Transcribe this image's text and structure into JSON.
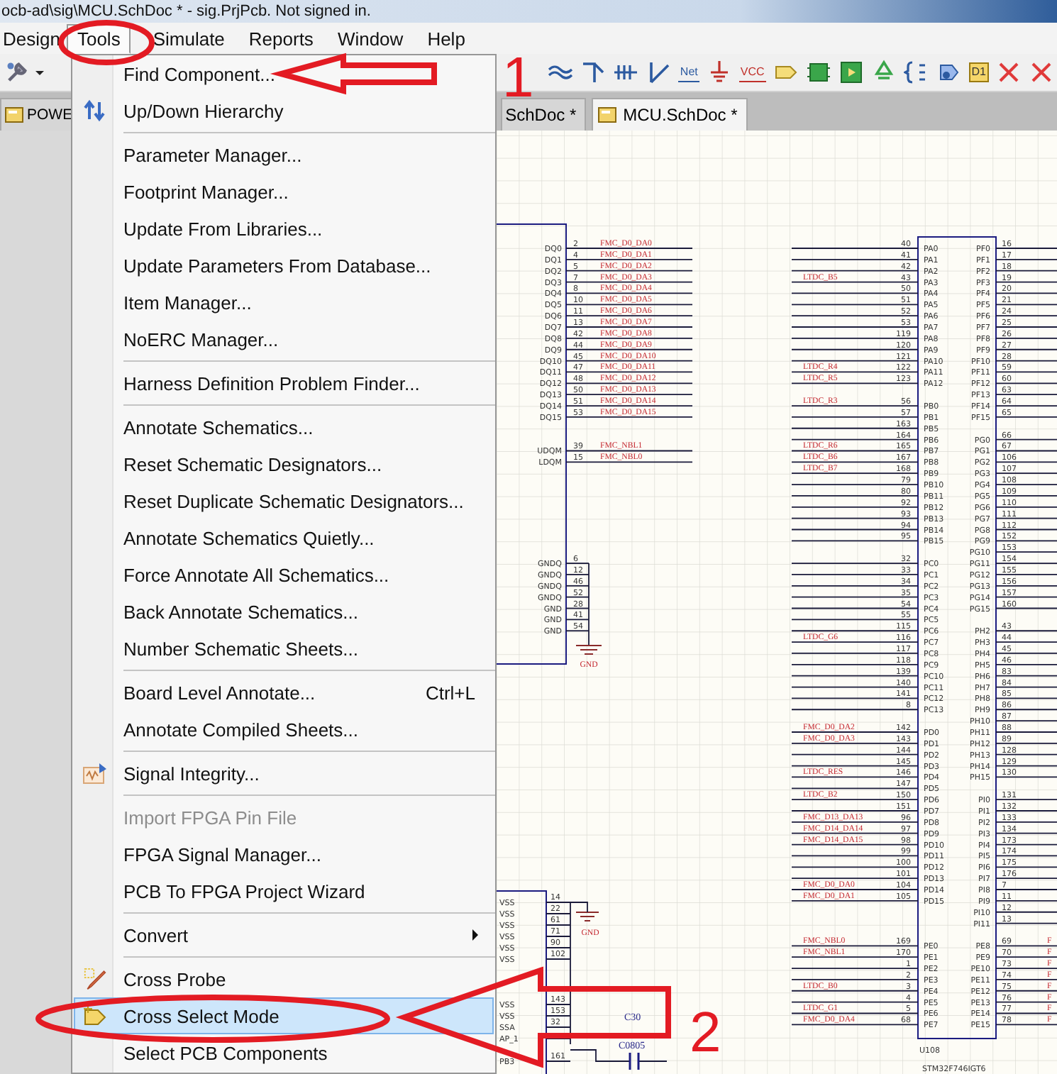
{
  "window": {
    "title": "ocb-ad\\sig\\MCU.SchDoc * - sig.PrjPcb. Not signed in."
  },
  "menubar": [
    {
      "label": "Design",
      "selected": false
    },
    {
      "label": "Tools",
      "selected": true
    },
    {
      "label": "Simulate",
      "selected": false
    },
    {
      "label": "Reports",
      "selected": false
    },
    {
      "label": "Window",
      "selected": false
    },
    {
      "label": "Help",
      "selected": false
    }
  ],
  "toolbar": {
    "left": [
      {
        "kind": "wrench"
      },
      {
        "kind": "caret"
      }
    ],
    "right": [
      {
        "kind": "bus"
      },
      {
        "kind": "bus-entry"
      },
      {
        "kind": "harness"
      },
      {
        "kind": "wire"
      },
      {
        "kind": "net-label",
        "label": "Net"
      },
      {
        "kind": "ground"
      },
      {
        "kind": "power",
        "label": "VCC"
      },
      {
        "kind": "port"
      },
      {
        "kind": "part"
      },
      {
        "kind": "sheet"
      },
      {
        "kind": "recycle"
      },
      {
        "kind": "brace"
      },
      {
        "kind": "sheet-entry"
      },
      {
        "kind": "off-sheet",
        "label": "D1"
      },
      {
        "kind": "cross"
      },
      {
        "kind": "cross"
      }
    ]
  },
  "tabs": [
    {
      "label": "POWE",
      "selected": false
    },
    {
      "label": "SchDoc *",
      "selected": false
    },
    {
      "label": "MCU.SchDoc *",
      "selected": true
    }
  ],
  "tools_menu": [
    {
      "kind": "item",
      "label": "Find Component...",
      "disabled": false,
      "selected": false
    },
    {
      "kind": "item",
      "label": "Up/Down Hierarchy",
      "disabled": false,
      "selected": false
    },
    {
      "kind": "separator"
    },
    {
      "kind": "item",
      "label": "Parameter Manager...",
      "disabled": false,
      "selected": false
    },
    {
      "kind": "item",
      "label": "Footprint Manager...",
      "disabled": false,
      "selected": false
    },
    {
      "kind": "item",
      "label": "Update From Libraries...",
      "disabled": false,
      "selected": false
    },
    {
      "kind": "item",
      "label": "Update Parameters From Database...",
      "disabled": false,
      "selected": false
    },
    {
      "kind": "item",
      "label": "Item Manager...",
      "disabled": false,
      "selected": false
    },
    {
      "kind": "item",
      "label": "NoERC Manager...",
      "disabled": false,
      "selected": false
    },
    {
      "kind": "separator"
    },
    {
      "kind": "item",
      "label": "Harness Definition Problem Finder...",
      "disabled": false,
      "selected": false
    },
    {
      "kind": "separator"
    },
    {
      "kind": "item",
      "label": "Annotate Schematics...",
      "disabled": false,
      "selected": false
    },
    {
      "kind": "item",
      "label": "Reset Schematic Designators...",
      "disabled": false,
      "selected": false
    },
    {
      "kind": "item",
      "label": "Reset Duplicate Schematic Designators...",
      "disabled": false,
      "selected": false
    },
    {
      "kind": "item",
      "label": "Annotate Schematics Quietly...",
      "disabled": false,
      "selected": false
    },
    {
      "kind": "item",
      "label": "Force Annotate All Schematics...",
      "disabled": false,
      "selected": false
    },
    {
      "kind": "item",
      "label": "Back Annotate Schematics...",
      "disabled": false,
      "selected": false
    },
    {
      "kind": "item",
      "label": "Number Schematic Sheets...",
      "disabled": false,
      "selected": false
    },
    {
      "kind": "separator"
    },
    {
      "kind": "item",
      "label": "Board Level Annotate...",
      "shortcut": "Ctrl+L",
      "disabled": false,
      "selected": false
    },
    {
      "kind": "item",
      "label": "Annotate Compiled Sheets...",
      "disabled": false,
      "selected": false
    },
    {
      "kind": "separator"
    },
    {
      "kind": "item",
      "label": "Signal Integrity...",
      "disabled": false,
      "selected": false
    },
    {
      "kind": "separator"
    },
    {
      "kind": "item",
      "label": "Import FPGA Pin File",
      "disabled": true,
      "selected": false
    },
    {
      "kind": "item",
      "label": "FPGA Signal Manager...",
      "disabled": false,
      "selected": false
    },
    {
      "kind": "item",
      "label": "PCB To FPGA Project Wizard",
      "disabled": false,
      "selected": false
    },
    {
      "kind": "separator"
    },
    {
      "kind": "item",
      "label": "Convert",
      "submenu": true,
      "disabled": false,
      "selected": false
    },
    {
      "kind": "separator"
    },
    {
      "kind": "item",
      "label": "Cross Probe",
      "disabled": false,
      "selected": false
    },
    {
      "kind": "item",
      "label": "Cross Select Mode",
      "disabled": false,
      "selected": true
    },
    {
      "kind": "item",
      "label": "Select PCB Components",
      "disabled": false,
      "selected": false
    }
  ],
  "schematic": {
    "memory_chip": {
      "groups": [
        {
          "kind": "signal",
          "pins": [
            {
              "name": "DQ0",
              "pin": "2",
              "net": "FMC_D0_DA0"
            },
            {
              "name": "DQ1",
              "pin": "4",
              "net": "FMC_D0_DA1"
            },
            {
              "name": "DQ2",
              "pin": "5",
              "net": "FMC_D0_DA2"
            },
            {
              "name": "DQ3",
              "pin": "7",
              "net": "FMC_D0_DA3"
            },
            {
              "name": "DQ4",
              "pin": "8",
              "net": "FMC_D0_DA4"
            },
            {
              "name": "DQ5",
              "pin": "10",
              "net": "FMC_D0_DA5"
            },
            {
              "name": "DQ6",
              "pin": "11",
              "net": "FMC_D0_DA6"
            },
            {
              "name": "DQ7",
              "pin": "13",
              "net": "FMC_D0_DA7"
            },
            {
              "name": "DQ8",
              "pin": "42",
              "net": "FMC_D0_DA8"
            },
            {
              "name": "DQ9",
              "pin": "44",
              "net": "FMC_D0_DA9"
            },
            {
              "name": "DQ10",
              "pin": "45",
              "net": "FMC_D0_DA10"
            },
            {
              "name": "DQ11",
              "pin": "47",
              "net": "FMC_D0_DA11"
            },
            {
              "name": "DQ12",
              "pin": "48",
              "net": "FMC_D0_DA12"
            },
            {
              "name": "DQ13",
              "pin": "50",
              "net": "FMC_D0_DA13"
            },
            {
              "name": "DQ14",
              "pin": "51",
              "net": "FMC_D0_DA14"
            },
            {
              "name": "DQ15",
              "pin": "53",
              "net": "FMC_D0_DA15"
            }
          ]
        },
        {
          "kind": "signal",
          "pins": [
            {
              "name": "UDQM",
              "pin": "39",
              "net": "FMC_NBL1"
            },
            {
              "name": "LDQM",
              "pin": "15",
              "net": "FMC_NBL0"
            }
          ]
        },
        {
          "kind": "ground",
          "ground_label": "GND",
          "pins": [
            {
              "name": "GNDQ",
              "pin": "6"
            },
            {
              "name": "GNDQ",
              "pin": "12"
            },
            {
              "name": "GNDQ",
              "pin": "46"
            },
            {
              "name": "GNDQ",
              "pin": "52"
            },
            {
              "name": "GND",
              "pin": "28"
            },
            {
              "name": "GND",
              "pin": "41"
            },
            {
              "name": "GND",
              "pin": "54"
            }
          ]
        }
      ]
    },
    "mcu": {
      "designator": "U108",
      "part": "STM32F746IGT6",
      "left_groups": [
        [
          {
            "name": "PA0",
            "pin": "40"
          },
          {
            "name": "PA1",
            "pin": "41"
          },
          {
            "name": "PA2",
            "pin": "42"
          },
          {
            "name": "PA3",
            "pin": "43",
            "net": "LTDC_B5"
          },
          {
            "name": "PA4",
            "pin": "50"
          },
          {
            "name": "PA5",
            "pin": "51"
          },
          {
            "name": "PA6",
            "pin": "52"
          },
          {
            "name": "PA7",
            "pin": "53"
          },
          {
            "name": "PA8",
            "pin": "119"
          },
          {
            "name": "PA9",
            "pin": "120"
          },
          {
            "name": "PA10",
            "pin": "121"
          },
          {
            "name": "PA11",
            "pin": "122",
            "net": "LTDC_R4"
          },
          {
            "name": "PA12",
            "pin": "123",
            "net": "LTDC_R5"
          }
        ],
        [
          {
            "name": "PB0",
            "pin": "56",
            "net": "LTDC_R3"
          },
          {
            "name": "PB1",
            "pin": "57"
          },
          {
            "name": "PB5",
            "pin": "163"
          },
          {
            "name": "PB6",
            "pin": "164"
          },
          {
            "name": "PB7",
            "pin": "165",
            "net": "LTDC_R6"
          },
          {
            "name": "PB8",
            "pin": "167",
            "net": "LTDC_B6"
          },
          {
            "name": "PB9",
            "pin": "168",
            "net": "LTDC_B7"
          },
          {
            "name": "PB10",
            "pin": "79"
          },
          {
            "name": "PB11",
            "pin": "80"
          },
          {
            "name": "PB12",
            "pin": "92"
          },
          {
            "name": "PB13",
            "pin": "93"
          },
          {
            "name": "PB14",
            "pin": "94"
          },
          {
            "name": "PB15",
            "pin": "95"
          }
        ],
        [
          {
            "name": "PC0",
            "pin": "32"
          },
          {
            "name": "PC1",
            "pin": "33"
          },
          {
            "name": "PC2",
            "pin": "34"
          },
          {
            "name": "PC3",
            "pin": "35"
          },
          {
            "name": "PC4",
            "pin": "54"
          },
          {
            "name": "PC5",
            "pin": "55"
          },
          {
            "name": "PC6",
            "pin": "115"
          },
          {
            "name": "PC7",
            "pin": "116",
            "net": "LTDC_G6"
          },
          {
            "name": "PC8",
            "pin": "117"
          },
          {
            "name": "PC9",
            "pin": "118"
          },
          {
            "name": "PC10",
            "pin": "139"
          },
          {
            "name": "PC11",
            "pin": "140"
          },
          {
            "name": "PC12",
            "pin": "141"
          },
          {
            "name": "PC13",
            "pin": "8"
          }
        ],
        [
          {
            "name": "PD0",
            "pin": "142",
            "net": "FMC_D0_DA2"
          },
          {
            "name": "PD1",
            "pin": "143",
            "net": "FMC_D0_DA3"
          },
          {
            "name": "PD2",
            "pin": "144"
          },
          {
            "name": "PD3",
            "pin": "145"
          },
          {
            "name": "PD4",
            "pin": "146",
            "net": "LTDC_RES"
          },
          {
            "name": "PD5",
            "pin": "147"
          },
          {
            "name": "PD6",
            "pin": "150",
            "net": "LTDC_B2"
          },
          {
            "name": "PD7",
            "pin": "151"
          },
          {
            "name": "PD8",
            "pin": "96",
            "net": "FMC_D13_DA13"
          },
          {
            "name": "PD9",
            "pin": "97",
            "net": "FMC_D14_DA14"
          },
          {
            "name": "PD10",
            "pin": "98",
            "net": "FMC_D14_DA15"
          },
          {
            "name": "PD11",
            "pin": "99"
          },
          {
            "name": "PD12",
            "pin": "100"
          },
          {
            "name": "PD13",
            "pin": "101"
          },
          {
            "name": "PD14",
            "pin": "104",
            "net": "FMC_D0_DA0"
          },
          {
            "name": "PD15",
            "pin": "105",
            "net": "FMC_D0_DA1"
          }
        ],
        [
          {
            "name": "PE0",
            "pin": "169",
            "net": "FMC_NBL0"
          },
          {
            "name": "PE1",
            "pin": "170",
            "net": "FMC_NBL1"
          },
          {
            "name": "PE2",
            "pin": "1"
          },
          {
            "name": "PE3",
            "pin": "2"
          },
          {
            "name": "PE4",
            "pin": "3",
            "net": "LTDC_B0"
          },
          {
            "name": "PE5",
            "pin": "4"
          },
          {
            "name": "PE6",
            "pin": "5",
            "net": "LTDC_G1"
          },
          {
            "name": "PE7",
            "pin": "68",
            "net": "FMC_D0_DA4"
          }
        ]
      ],
      "right_groups": [
        [
          {
            "name": "PF0",
            "pin": "16"
          },
          {
            "name": "PF1",
            "pin": "17"
          },
          {
            "name": "PF2",
            "pin": "18"
          },
          {
            "name": "PF3",
            "pin": "19"
          },
          {
            "name": "PF4",
            "pin": "20"
          },
          {
            "name": "PF5",
            "pin": "21"
          },
          {
            "name": "PF6",
            "pin": "24"
          },
          {
            "name": "PF7",
            "pin": "25"
          },
          {
            "name": "PF8",
            "pin": "26"
          },
          {
            "name": "PF9",
            "pin": "27"
          },
          {
            "name": "PF10",
            "pin": "28"
          },
          {
            "name": "PF11",
            "pin": "59"
          },
          {
            "name": "PF12",
            "pin": "60"
          },
          {
            "name": "PF13",
            "pin": "63"
          },
          {
            "name": "PF14",
            "pin": "64"
          },
          {
            "name": "PF15",
            "pin": "65"
          }
        ],
        [
          {
            "name": "PG0",
            "pin": "66"
          },
          {
            "name": "PG1",
            "pin": "67"
          },
          {
            "name": "PG2",
            "pin": "106"
          },
          {
            "name": "PG3",
            "pin": "107"
          },
          {
            "name": "PG4",
            "pin": "108"
          },
          {
            "name": "PG5",
            "pin": "109"
          },
          {
            "name": "PG6",
            "pin": "110"
          },
          {
            "name": "PG7",
            "pin": "111"
          },
          {
            "name": "PG8",
            "pin": "112"
          },
          {
            "name": "PG9",
            "pin": "152"
          },
          {
            "name": "PG10",
            "pin": "153"
          },
          {
            "name": "PG11",
            "pin": "154"
          },
          {
            "name": "PG12",
            "pin": "155"
          },
          {
            "name": "PG13",
            "pin": "156"
          },
          {
            "name": "PG14",
            "pin": "157"
          },
          {
            "name": "PG15",
            "pin": "160"
          }
        ],
        [
          {
            "name": "PH2",
            "pin": "43"
          },
          {
            "name": "PH3",
            "pin": "44"
          },
          {
            "name": "PH4",
            "pin": "45"
          },
          {
            "name": "PH5",
            "pin": "46"
          },
          {
            "name": "PH6",
            "pin": "83"
          },
          {
            "name": "PH7",
            "pin": "84"
          },
          {
            "name": "PH8",
            "pin": "85"
          },
          {
            "name": "PH9",
            "pin": "86"
          },
          {
            "name": "PH10",
            "pin": "87"
          },
          {
            "name": "PH11",
            "pin": "88"
          },
          {
            "name": "PH12",
            "pin": "89"
          },
          {
            "name": "PH13",
            "pin": "128"
          },
          {
            "name": "PH14",
            "pin": "129"
          },
          {
            "name": "PH15",
            "pin": "130"
          }
        ],
        [
          {
            "name": "PI0",
            "pin": "131"
          },
          {
            "name": "PI1",
            "pin": "132"
          },
          {
            "name": "PI2",
            "pin": "133"
          },
          {
            "name": "PI3",
            "pin": "134"
          },
          {
            "name": "PI4",
            "pin": "173"
          },
          {
            "name": "PI5",
            "pin": "174"
          },
          {
            "name": "PI6",
            "pin": "175"
          },
          {
            "name": "PI7",
            "pin": "176"
          },
          {
            "name": "PI8",
            "pin": "7"
          },
          {
            "name": "PI9",
            "pin": "11"
          },
          {
            "name": "PI10",
            "pin": "12"
          },
          {
            "name": "PI11",
            "pin": "13"
          }
        ],
        [
          {
            "name": "PE8",
            "pin": "69",
            "net": "F"
          },
          {
            "name": "PE9",
            "pin": "70",
            "net": "F"
          },
          {
            "name": "PE10",
            "pin": "73",
            "net": "F"
          },
          {
            "name": "PE11",
            "pin": "74",
            "net": "F"
          },
          {
            "name": "PE12",
            "pin": "75",
            "net": "F"
          },
          {
            "name": "PE13",
            "pin": "76",
            "net": "F"
          },
          {
            "name": "PE14",
            "pin": "77",
            "net": "F"
          },
          {
            "name": "PE15",
            "pin": "78",
            "net": "F"
          }
        ]
      ]
    },
    "power_part": {
      "ground_label": "GND",
      "groups": [
        [
          {
            "name": "VSS",
            "pin": "14"
          },
          {
            "name": "VSS",
            "pin": "22"
          },
          {
            "name": "VSS",
            "pin": "61"
          },
          {
            "name": "VSS",
            "pin": "71"
          },
          {
            "name": "VSS",
            "pin": "90"
          },
          {
            "name": "VSS",
            "pin": "102"
          }
        ],
        [
          {
            "name": "VSS",
            "pin": "143"
          },
          {
            "name": "VSS",
            "pin": "153"
          },
          {
            "name": "SSA",
            "pin": "32"
          },
          {
            "name": "AP_1"
          }
        ],
        [
          {
            "name": "PB3",
            "pin": "161"
          }
        ]
      ]
    },
    "capacitor": {
      "designator": "C30",
      "footprint": "C0805"
    }
  },
  "annotations": [
    {
      "number": "1"
    },
    {
      "number": "2"
    }
  ]
}
